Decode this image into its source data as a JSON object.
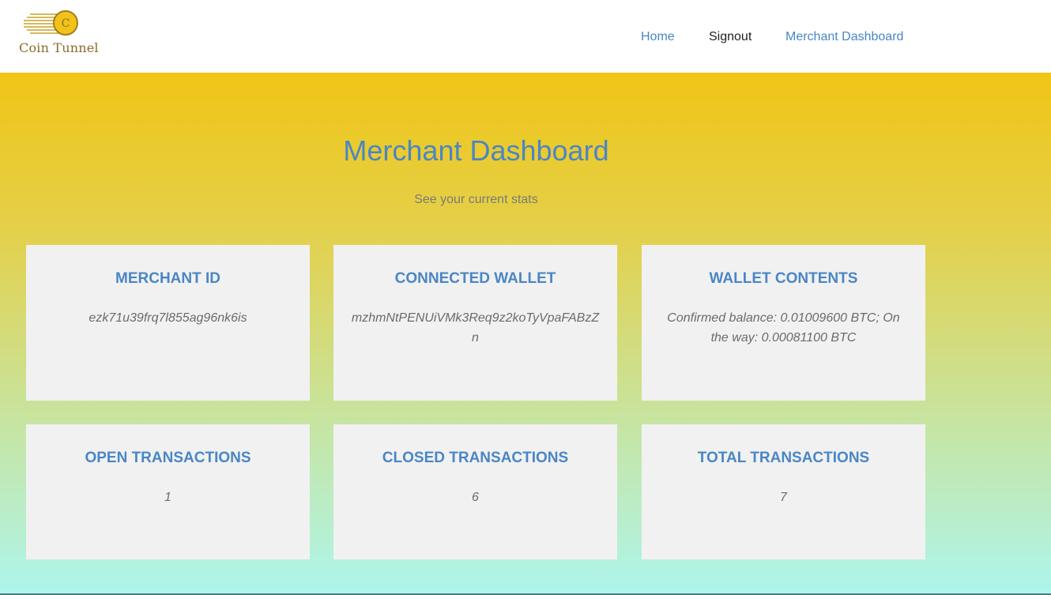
{
  "header": {
    "logo_text": "Coin Tunnel",
    "logo_letter": "C",
    "nav": [
      {
        "label": "Home"
      },
      {
        "label": "Signout"
      },
      {
        "label": "Merchant Dashboard"
      }
    ]
  },
  "main": {
    "title": "Merchant Dashboard",
    "subtitle": "See your current stats",
    "cards": [
      {
        "title": "MERCHANT ID",
        "value": "ezk71u39frq7l855ag96nk6is"
      },
      {
        "title": "CONNECTED WALLET",
        "value": "mzhmNtPENUiVMk3Req9z2koTyVpaFABzZn"
      },
      {
        "title": "WALLET CONTENTS",
        "value": "Confirmed balance: 0.01009600 BTC; On the way: 0.00081100 BTC"
      },
      {
        "title": "OPEN TRANSACTIONS",
        "value": "1"
      },
      {
        "title": "CLOSED TRANSACTIONS",
        "value": "6"
      },
      {
        "title": "TOTAL TRANSACTIONS",
        "value": "7"
      }
    ]
  },
  "colors": {
    "accent": "#4a86c5",
    "gradient_top": "#f0c515",
    "gradient_bottom": "#aef5ec",
    "card_bg": "#f1f1f1"
  }
}
